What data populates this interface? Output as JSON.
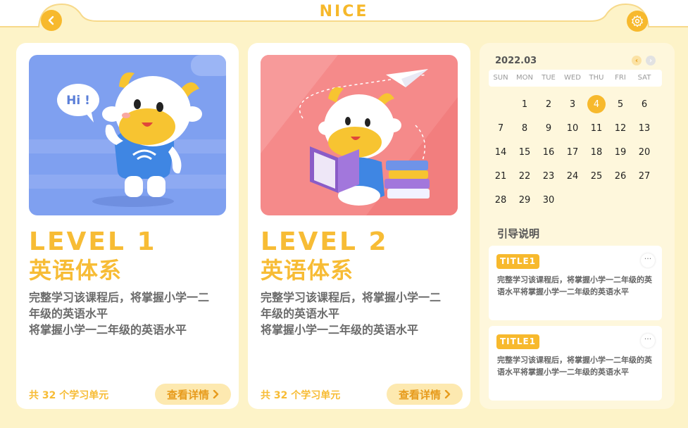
{
  "header": {
    "title": "NICE",
    "back_icon": "chevron-left-icon",
    "settings_icon": "gear-icon"
  },
  "courses": [
    {
      "level": "LEVEL 1",
      "subject": "英语体系",
      "desc_lines": [
        "完整学习该课程后，将掌握小学一二",
        "年级的英语水平",
        "将掌握小学一二年级的英语水平"
      ],
      "units": "共 32 个学习单元",
      "detail_label": "查看详情",
      "illustration_text": "Hi !"
    },
    {
      "level": "LEVEL 2",
      "subject": "英语体系",
      "desc_lines": [
        "完整学习该课程后，将掌握小学一二",
        "年级的英语水平",
        "将掌握小学一二年级的英语水平"
      ],
      "units": "共 32 个学习单元",
      "detail_label": "查看详情"
    }
  ],
  "calendar": {
    "month": "2022.03",
    "weekdays": [
      "SUN",
      "MON",
      "TUE",
      "WED",
      "THU",
      "FRI",
      "SAT"
    ],
    "weeks": [
      [
        "",
        "1",
        "2",
        "3",
        "4",
        "5",
        "6"
      ],
      [
        "7",
        "8",
        "9",
        "10",
        "11",
        "12",
        "13"
      ],
      [
        "14",
        "15",
        "16",
        "17",
        "18",
        "19",
        "20"
      ],
      [
        "21",
        "22",
        "23",
        "24",
        "25",
        "26",
        "27"
      ],
      [
        "28",
        "29",
        "30",
        "",
        "",
        "",
        ""
      ]
    ],
    "selected_day": "4"
  },
  "guide": {
    "title": "引导说明",
    "notes": [
      {
        "badge": "TITLE1",
        "more": "···",
        "body": "完整学习该课程后，将掌握小学一二年级的英语水平将掌握小学一二年级的英语水平"
      },
      {
        "badge": "TITLE1",
        "more": "···",
        "body": "完整学习该课程后，将掌握小学一二年级的英语水平将掌握小学一二年级的英语水平"
      }
    ]
  },
  "colors": {
    "background": "#fdf3c8",
    "accent": "#f7b92d",
    "card": "#ffffff",
    "illustration_1": "#7fa0f0",
    "illustration_2": "#f58a8a"
  }
}
